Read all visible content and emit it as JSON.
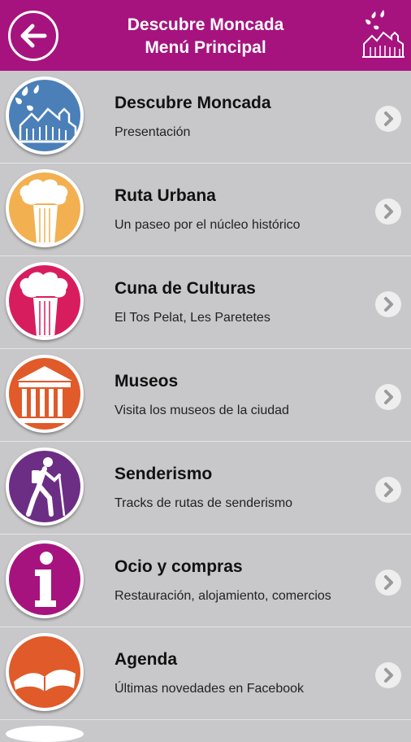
{
  "header": {
    "title_line1": "Descubre Moncada",
    "title_line2": "Menú Principal",
    "bg_color": "#a6137e"
  },
  "menu": [
    {
      "title": "Descubre Moncada",
      "subtitle": "Presentación",
      "icon": "church-icon",
      "color": "#4a7fb8"
    },
    {
      "title": "Ruta Urbana",
      "subtitle": "Un paseo por el núcleo histórico",
      "icon": "column-icon",
      "color": "#f3b050"
    },
    {
      "title": "Cuna de Culturas",
      "subtitle": "El Tos Pelat, Les Paretetes",
      "icon": "column-icon",
      "color": "#d81d5f"
    },
    {
      "title": "Museos",
      "subtitle": "Visita los museos de la ciudad",
      "icon": "museum-icon",
      "color": "#e05a2a"
    },
    {
      "title": "Senderismo",
      "subtitle": "Tracks de rutas de senderismo",
      "icon": "hiker-icon",
      "color": "#6c2d85"
    },
    {
      "title": "Ocio y compras",
      "subtitle": "Restauración, alojamiento, comercios",
      "icon": "info-icon",
      "color": "#a6137e"
    },
    {
      "title": "Agenda",
      "subtitle": "Últimas novedades en Facebook",
      "icon": "book-icon",
      "color": "#e05a2a"
    }
  ]
}
